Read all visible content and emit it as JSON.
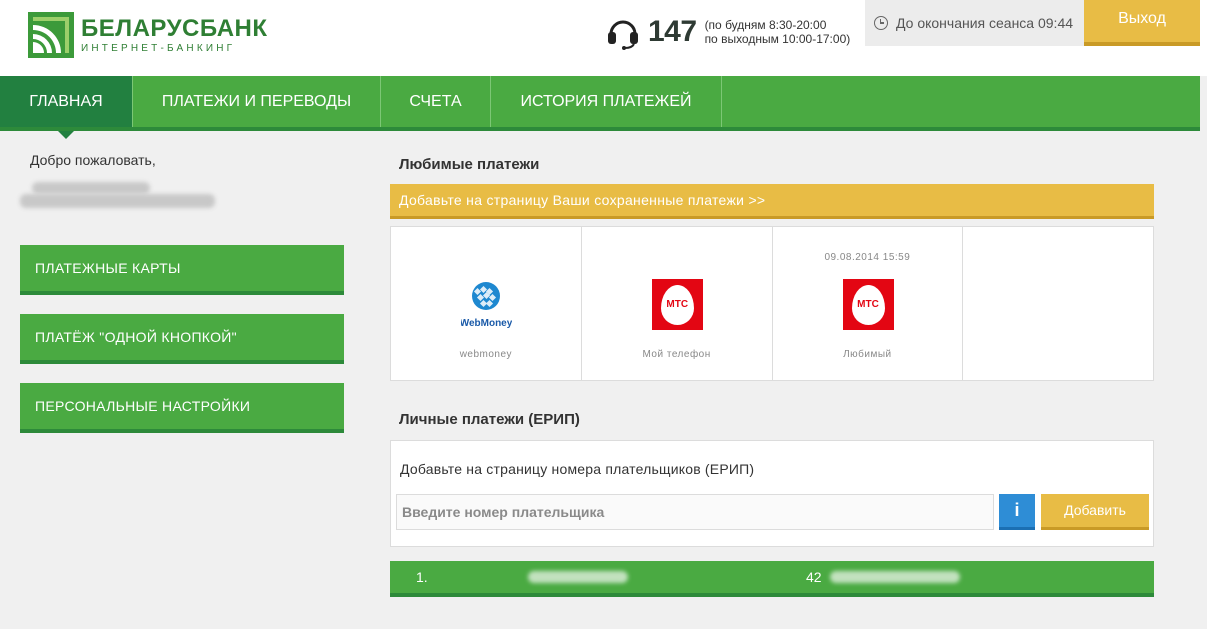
{
  "header": {
    "logo_name": "БЕЛАРУСБАНК",
    "logo_sub": "ИНТЕРНЕТ-БАНКИНГ",
    "phone_number": "147",
    "phone_hours_weekdays": "(по будням 8:30-20:00",
    "phone_hours_weekend": "по выходным 10:00-17:00)",
    "session_text": "До окончания сеанса 09:44",
    "logout_label": "Выход"
  },
  "nav": {
    "items": [
      {
        "label": "ГЛАВНАЯ",
        "active": true
      },
      {
        "label": "ПЛАТЕЖИ И ПЕРЕВОДЫ",
        "active": false
      },
      {
        "label": "СЧЕТА",
        "active": false
      },
      {
        "label": "ИСТОРИЯ ПЛАТЕЖЕЙ",
        "active": false
      }
    ]
  },
  "sidebar": {
    "welcome": "Добро пожаловать,",
    "buttons": [
      {
        "label": "ПЛАТЕЖНЫЕ КАРТЫ"
      },
      {
        "label": "ПЛАТЁЖ \"ОДНОЙ КНОПКОЙ\""
      },
      {
        "label": "ПЕРСОНАЛЬНЫЕ НАСТРОЙКИ"
      }
    ]
  },
  "favorites": {
    "title": "Любимые платежи",
    "banner": "Добавьте на страницу Ваши сохраненные платежи >>",
    "items": [
      {
        "date": "",
        "label": "webmoney",
        "logo_text": "WebMoney",
        "icon": "webmoney-icon"
      },
      {
        "date": "",
        "label": "Мой телефон",
        "logo_text": "МТС",
        "icon": "mts-icon"
      },
      {
        "date": "09.08.2014 15:59",
        "label": "Любимый",
        "logo_text": "МТС",
        "icon": "mts-icon"
      }
    ]
  },
  "erip": {
    "title": "Личные платежи (ЕРИП)",
    "hint": "Добавьте на страницу номера плательщиков (ЕРИП)",
    "input_placeholder": "Введите номер плательщика",
    "info_label": "i",
    "add_label": "Добавить"
  },
  "payers": [
    {
      "num": "1.",
      "account": "42"
    }
  ],
  "colors": {
    "green": "#4aaa42",
    "dark_green": "#228040",
    "gold": "#e8bc45",
    "info_blue": "#2e8dd6",
    "mts_red": "#e30613"
  }
}
